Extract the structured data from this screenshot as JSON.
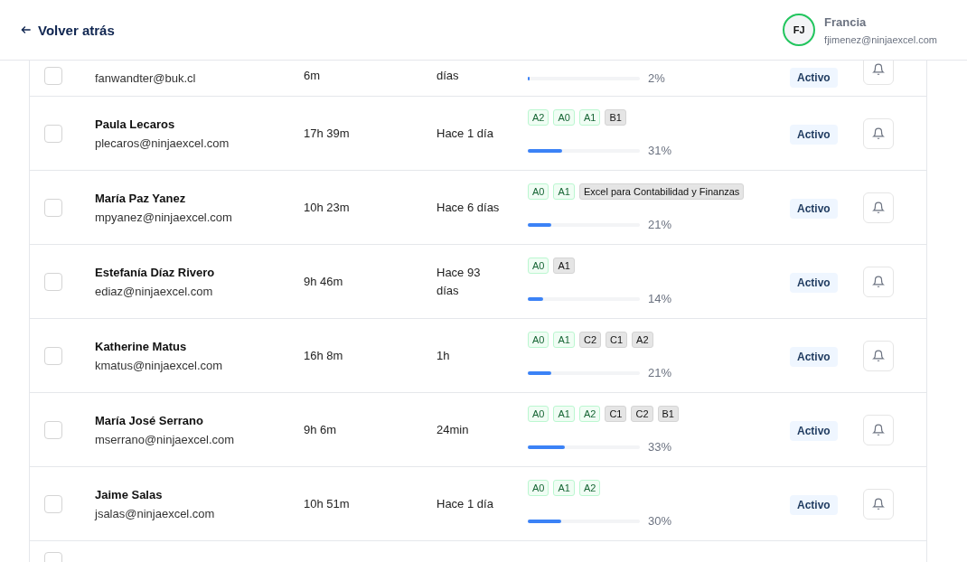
{
  "header": {
    "back_link": "Volver atrás",
    "user": {
      "initials": "FJ",
      "name": "Francia",
      "email": "fjimenez@ninjaexcel.com"
    }
  },
  "rows": [
    {
      "checked": false,
      "email": "fanwandter@buk.cl",
      "time": "6m",
      "last_activity": "días",
      "tags": [],
      "level": 0.02,
      "percent": "2%",
      "status": "Activo"
    },
    {
      "checked": false,
      "name": "Paula Lecaros",
      "email": "plecaros@ninjaexcel.com",
      "time": "17h 39m",
      "last_activity": "Hace 1 día",
      "tags": [
        {
          "label": "A2",
          "completed": true
        },
        {
          "label": "A0",
          "completed": true
        },
        {
          "label": "A1",
          "completed": true
        },
        {
          "label": "B1",
          "completed": false
        }
      ],
      "level": 0.31,
      "percent": "31%",
      "status": "Activo"
    },
    {
      "checked": false,
      "name": "María Paz Yanez",
      "email": "mpyanez@ninjaexcel.com",
      "time": "10h 23m",
      "last_activity": "Hace 6 días",
      "tags": [
        {
          "label": "A0",
          "completed": true
        },
        {
          "label": "A1",
          "completed": true
        },
        {
          "label": "Excel para Contabilidad y Finanzas",
          "completed": false
        }
      ],
      "level": 0.21,
      "percent": "21%",
      "status": "Activo"
    },
    {
      "checked": false,
      "name": "Estefanía Díaz Rivero",
      "email": "ediaz@ninjaexcel.com",
      "time": "9h 46m",
      "last_activity": "Hace 93 días",
      "tags": [
        {
          "label": "A0",
          "completed": true
        },
        {
          "label": "A1",
          "completed": false
        }
      ],
      "level": 0.14,
      "percent": "14%",
      "status": "Activo"
    },
    {
      "checked": false,
      "name": "Katherine Matus",
      "email": "kmatus@ninjaexcel.com",
      "time": "16h 8m",
      "last_activity": "1h",
      "tags": [
        {
          "label": "A0",
          "completed": true
        },
        {
          "label": "A1",
          "completed": true
        },
        {
          "label": "C2",
          "completed": false
        },
        {
          "label": "C1",
          "completed": false
        },
        {
          "label": "A2",
          "completed": false
        }
      ],
      "level": 0.21,
      "percent": "21%",
      "status": "Activo"
    },
    {
      "checked": false,
      "name": "María José Serrano",
      "email": "mserrano@ninjaexcel.com",
      "time": "9h 6m",
      "last_activity": "24min",
      "tags": [
        {
          "label": "A0",
          "completed": true
        },
        {
          "label": "A1",
          "completed": true
        },
        {
          "label": "A2",
          "completed": true
        },
        {
          "label": "C1",
          "completed": false
        },
        {
          "label": "C2",
          "completed": false
        },
        {
          "label": "B1",
          "completed": false
        }
      ],
      "level": 0.33,
      "percent": "33%",
      "status": "Activo"
    },
    {
      "checked": false,
      "name": "Jaime Salas",
      "email": "jsalas@ninjaexcel.com",
      "time": "10h 51m",
      "last_activity": "Hace 1 día",
      "tags": [
        {
          "label": "A0",
          "completed": true
        },
        {
          "label": "A1",
          "completed": true
        },
        {
          "label": "A2",
          "completed": true
        }
      ],
      "level": 0.3,
      "percent": "30%",
      "status": "Activo"
    },
    {
      "checked": false,
      "tags": []
    }
  ]
}
